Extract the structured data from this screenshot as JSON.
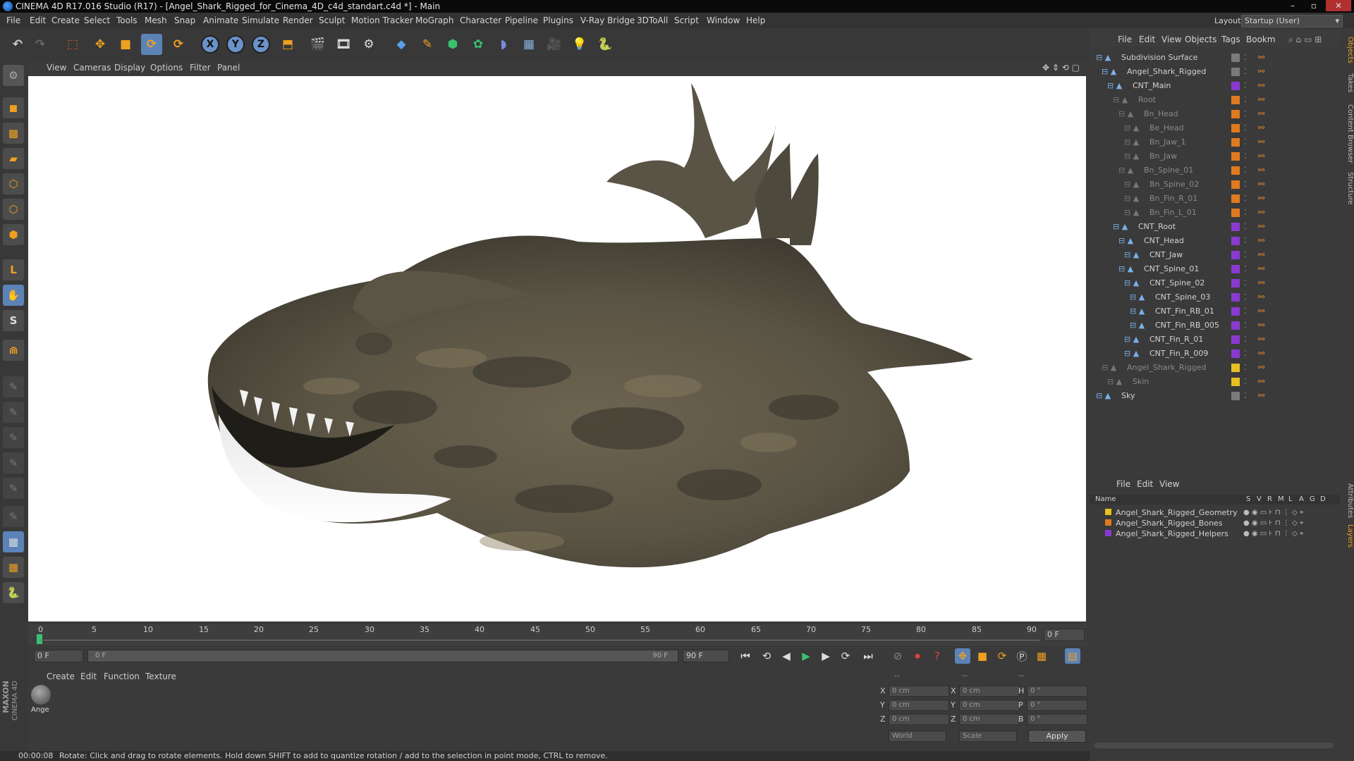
{
  "window": {
    "title": "CINEMA 4D R17.016 Studio (R17) - [Angel_Shark_Rigged_for_Cinema_4D_c4d_standart.c4d *] - Main",
    "controls": [
      "–",
      "▫",
      "✕"
    ]
  },
  "menubar": {
    "items": [
      "File",
      "Edit",
      "Create",
      "Select",
      "Tools",
      "Mesh",
      "Snap",
      "Animate",
      "Simulate",
      "Render",
      "Sculpt",
      "Motion Tracker",
      "MoGraph",
      "Character",
      "Pipeline",
      "Plugins",
      "V-Ray Bridge",
      "3DToAll",
      "Script",
      "Window",
      "Help"
    ],
    "layout_label": "Layout:",
    "layout_value": "Startup (User)"
  },
  "toolbar": {
    "axes": [
      "X",
      "Y",
      "Z"
    ]
  },
  "viewport": {
    "menu": [
      "View",
      "Cameras",
      "Display",
      "Options",
      "Filter",
      "Panel"
    ]
  },
  "timeline": {
    "ticks": [
      "0",
      "5",
      "10",
      "15",
      "20",
      "25",
      "30",
      "35",
      "40",
      "45",
      "50",
      "55",
      "60",
      "65",
      "70",
      "75",
      "80",
      "85",
      "90"
    ],
    "current_frame_field": "0 F",
    "end_frame_right": "0 F",
    "start_field": "0 F",
    "range_start": "0 F",
    "range_end": "90 F",
    "max_field": "90 F"
  },
  "material_manager": {
    "menu": [
      "Create",
      "Edit",
      "Function",
      "Texture"
    ],
    "materials": [
      {
        "name": "Ange"
      }
    ]
  },
  "coordinates": {
    "rows": [
      {
        "a": "X",
        "av": "0 cm",
        "b": "X",
        "bv": "0 cm",
        "c": "H",
        "cv": "0 °"
      },
      {
        "a": "Y",
        "av": "0 cm",
        "b": "Y",
        "bv": "0 cm",
        "c": "P",
        "cv": "0 °"
      },
      {
        "a": "Z",
        "av": "0 cm",
        "b": "Z",
        "bv": "0 cm",
        "c": "B",
        "cv": "0 °"
      }
    ],
    "mode": "World",
    "type": "Scale",
    "apply_label": "Apply",
    "header_dashes": [
      "--",
      "--",
      "--"
    ]
  },
  "status_bar": {
    "time": "00:00:08",
    "message": "Rotate: Click and drag to rotate elements. Hold down SHIFT to add to quantize rotation / add to the selection in point mode, CTRL to remove."
  },
  "object_manager": {
    "menu": [
      "File",
      "Edit",
      "View",
      "Objects",
      "Tags",
      "Bookm"
    ],
    "objects": [
      {
        "name": "Subdivision Surface",
        "dim": false
      },
      {
        "name": "Angel_Shark_Rigged",
        "dim": false
      },
      {
        "name": "CNT_Main",
        "dim": false
      },
      {
        "name": "Root",
        "dim": true
      },
      {
        "name": "Bn_Head",
        "dim": true
      },
      {
        "name": "Be_Head",
        "dim": true
      },
      {
        "name": "Bn_Jaw_1",
        "dim": true
      },
      {
        "name": "Bn_Jaw",
        "dim": true
      },
      {
        "name": "Bn_Spine_01",
        "dim": true
      },
      {
        "name": "Bn_Spine_02",
        "dim": true
      },
      {
        "name": "Bn_Fin_R_01",
        "dim": true
      },
      {
        "name": "Bn_Fin_L_01",
        "dim": true
      },
      {
        "name": "CNT_Root",
        "dim": false
      },
      {
        "name": "CNT_Head",
        "dim": false
      },
      {
        "name": "CNT_Jaw",
        "dim": false
      },
      {
        "name": "CNT_Spine_01",
        "dim": false
      },
      {
        "name": "CNT_Spine_02",
        "dim": false
      },
      {
        "name": "CNT_Spine_03",
        "dim": false
      },
      {
        "name": "CNT_Fin_RB_01",
        "dim": false
      },
      {
        "name": "CNT_Fin_RB_005",
        "dim": false
      },
      {
        "name": "CNT_Fin_R_01",
        "dim": false
      },
      {
        "name": "CNT_Fin_R_009",
        "dim": false
      },
      {
        "name": "Angel_Shark_Rigged",
        "dim": true
      },
      {
        "name": "Skin",
        "dim": true
      },
      {
        "name": "Sky",
        "dim": false
      }
    ]
  },
  "layer_manager": {
    "menu": [
      "File",
      "Edit",
      "View"
    ],
    "header_name": "Name",
    "header_cols": [
      "S",
      "V",
      "R",
      "M",
      "L",
      "A",
      "G",
      "D"
    ],
    "layers": [
      {
        "name": "Angel_Shark_Rigged_Geometry",
        "color": "#e8c020"
      },
      {
        "name": "Angel_Shark_Rigged_Bones",
        "color": "#e07a20"
      },
      {
        "name": "Angel_Shark_Rigged_Helpers",
        "color": "#8a3ad0"
      }
    ]
  },
  "side_tabs": {
    "top": [
      "Objects",
      "Takes",
      "Content Browser",
      "Structure"
    ],
    "bottom": [
      "Attributes",
      "Layers"
    ]
  },
  "branding": {
    "line1": "MAXON",
    "line2": "CINEMA 4D"
  }
}
